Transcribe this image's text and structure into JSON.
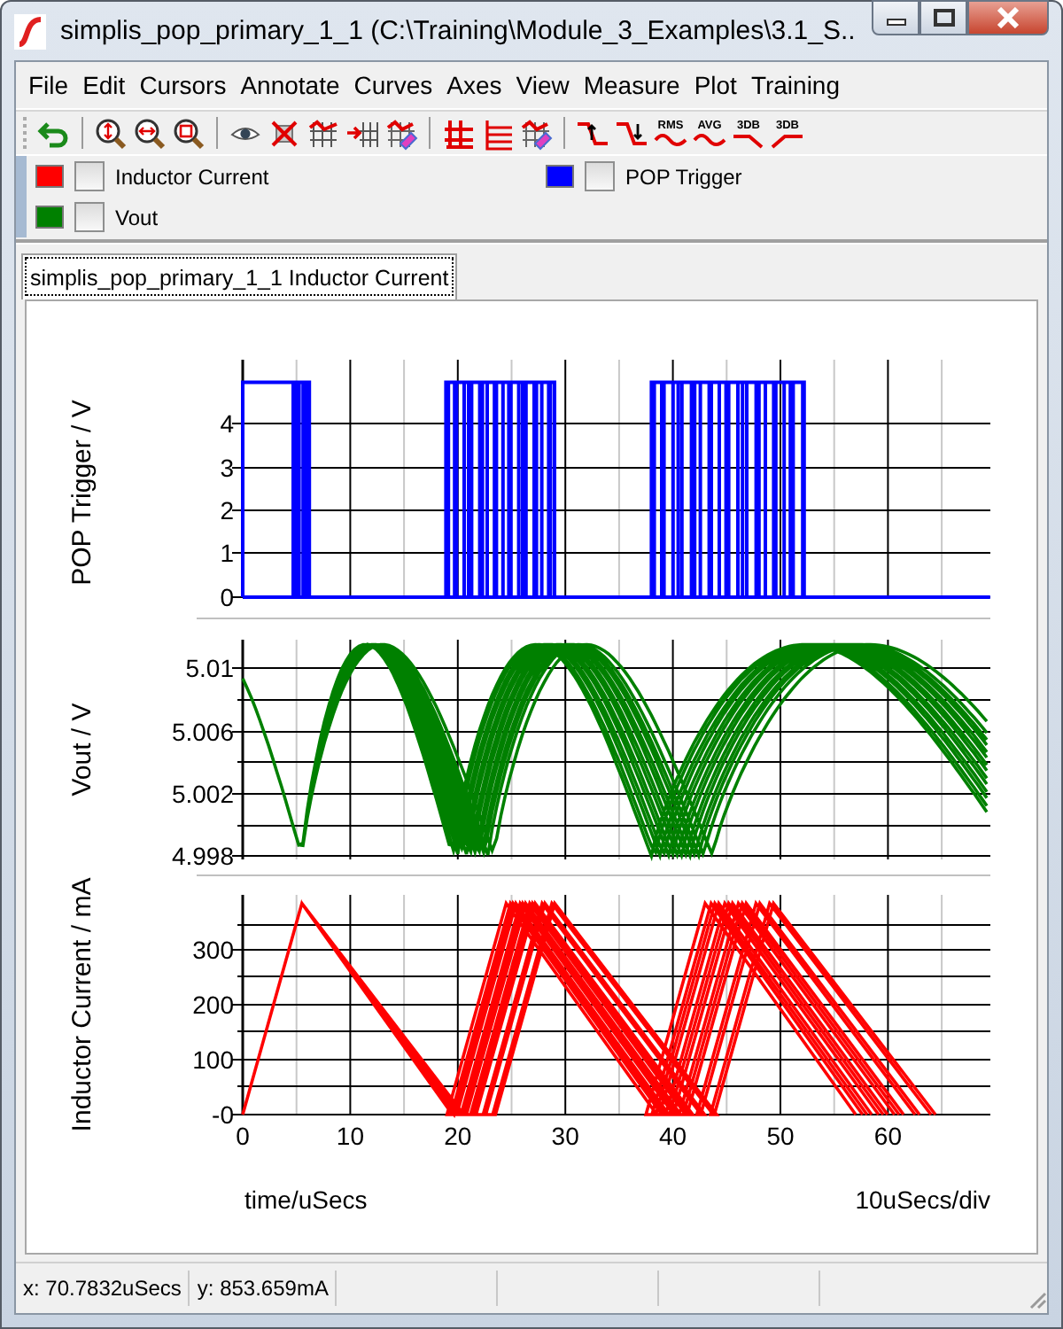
{
  "window": {
    "title": "simplis_pop_primary_1_1 (C:\\Training\\Module_3_Examples\\3.1_S..."
  },
  "menu": [
    "File",
    "Edit",
    "Cursors",
    "Annotate",
    "Curves",
    "Axes",
    "View",
    "Measure",
    "Plot",
    "Training"
  ],
  "toolbar": [
    {
      "kind": "undo"
    },
    {
      "kind": "separator"
    },
    {
      "kind": "zoom-fit"
    },
    {
      "kind": "zoom-width"
    },
    {
      "kind": "zoom-box"
    },
    {
      "kind": "separator"
    },
    {
      "kind": "eye"
    },
    {
      "kind": "delete"
    },
    {
      "kind": "abc-grid"
    },
    {
      "kind": "add-grid"
    },
    {
      "kind": "eraser"
    },
    {
      "kind": "separator"
    },
    {
      "kind": "grid"
    },
    {
      "kind": "grid-lines"
    },
    {
      "kind": "eraser"
    },
    {
      "kind": "separator"
    },
    {
      "kind": "rise"
    },
    {
      "kind": "fall"
    },
    {
      "kind": "wave",
      "label": "RMS"
    },
    {
      "kind": "wave",
      "label": "AVG"
    },
    {
      "kind": "fall-3db",
      "label": "3DB"
    },
    {
      "kind": "rise-3db",
      "label": "3DB"
    }
  ],
  "legend": [
    {
      "label": "Inductor Current",
      "color": "#ff0000",
      "checked": false
    },
    {
      "label": "POP Trigger",
      "color": "#0000ff",
      "checked": false
    },
    {
      "label": "Vout",
      "color": "#008000",
      "checked": false
    }
  ],
  "tabs": [
    {
      "label": "simplis_pop_primary_1_1 Inductor Current",
      "selected": true
    }
  ],
  "plots": [
    {
      "kind": "pulse",
      "ylabel": "POP Trigger / V",
      "yticks": [
        "4",
        "3",
        "2",
        "1",
        "0"
      ],
      "color": "#0000ff"
    },
    {
      "kind": "ripple",
      "ylabel": "Vout / V",
      "yticks": [
        "5.01",
        "5.006",
        "5.002",
        "4.998"
      ],
      "color": "#008000"
    },
    {
      "kind": "sawtooth",
      "ylabel": "Inductor Current / mA",
      "yticks": [
        "300",
        "200",
        "100",
        "-0"
      ],
      "color": "#ff0000"
    }
  ],
  "x_axis": {
    "ticks": [
      "0",
      "10",
      "20",
      "30",
      "40",
      "50",
      "60"
    ],
    "label": "time/uSecs",
    "scale": "10uSecs/div"
  },
  "status_bar": [
    "x: 70.7832uSecs",
    "y: 853.659mA"
  ]
}
